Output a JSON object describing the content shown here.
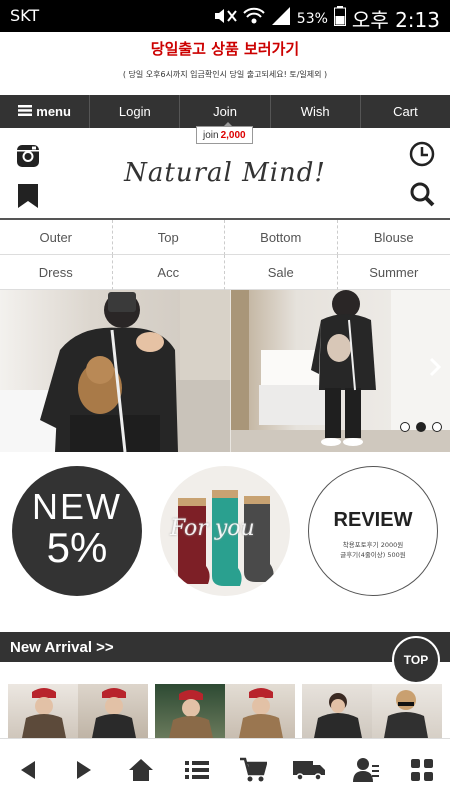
{
  "status_bar": {
    "carrier": "SKT",
    "battery": "53%",
    "time": "오후 2:13"
  },
  "notice": {
    "headline": "당일출고 상품 보러가기",
    "subtext": "( 당일 오후6시까지 입금확인시 당일 출고되세요! 토/일제외 )"
  },
  "menu": {
    "menu_label": "menu",
    "items": [
      "Login",
      "Join",
      "Wish",
      "Cart"
    ],
    "join_tip_label": "join",
    "join_tip_value": "2,000"
  },
  "header": {
    "logo": "Natural Mind!",
    "icons": [
      "instagram-icon",
      "bookmark-icon",
      "clock-icon",
      "search-icon"
    ]
  },
  "categories": [
    "Outer",
    "Top",
    "Bottom",
    "Blouse",
    "Dress",
    "Acc",
    "Sale",
    "Summer"
  ],
  "banner": {
    "slide_count": 3,
    "active_slide": 2
  },
  "promos": {
    "new_line1": "NEW",
    "new_line2": "5%",
    "socks_overlay": "For you",
    "review_title": "REVIEW",
    "review_line1": "착용포토후기 2000원",
    "review_line2": "글후기(4줄이상) 500원"
  },
  "section": {
    "new_arrival": "New Arrival >>",
    "top_button": "TOP"
  },
  "colors": {
    "dark_bar": "#333333",
    "notice_red": "#cc0000",
    "join_value_red": "#dd0000"
  }
}
